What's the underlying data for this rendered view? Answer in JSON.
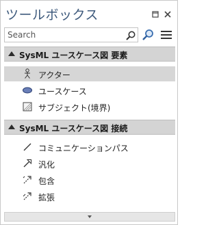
{
  "panel": {
    "title": "ツールボックス",
    "search": {
      "placeholder": "Search",
      "value": ""
    },
    "icons": {
      "pin": "pin-icon",
      "close": "close-icon",
      "search": "search-icon",
      "find": "find-icon",
      "menu": "menu-icon"
    }
  },
  "groups": [
    {
      "label": "SysML ユースケース図 要素",
      "expanded": true,
      "items": [
        {
          "label": "アクター",
          "icon": "actor-icon",
          "selected": true
        },
        {
          "label": "ユースケース",
          "icon": "use-case-icon",
          "selected": false
        },
        {
          "label": "サブジェクト(境界)",
          "icon": "subject-boundary-icon",
          "selected": false
        }
      ]
    },
    {
      "label": "SysML ユースケース図 接続",
      "expanded": true,
      "items": [
        {
          "label": "コミュニケーションパス",
          "icon": "communication-path-icon",
          "selected": false
        },
        {
          "label": "汎化",
          "icon": "generalization-icon",
          "selected": false
        },
        {
          "label": "包含",
          "icon": "include-icon",
          "selected": false
        },
        {
          "label": "拡張",
          "icon": "extend-icon",
          "selected": false
        }
      ]
    }
  ],
  "colors": {
    "title": "#3e5a7c",
    "header_bg": "#d4d4d4",
    "selected_bg": "#d6d6d6",
    "usecase_fill": "#6a7fb8"
  }
}
